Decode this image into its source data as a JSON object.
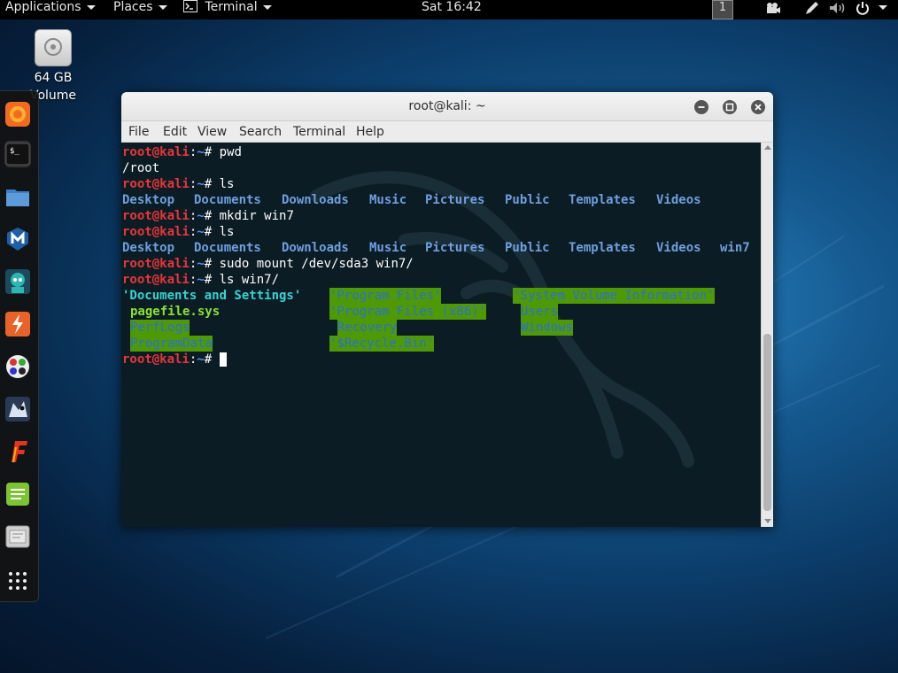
{
  "topbar": {
    "applications_label": "Applications",
    "places_label": "Places",
    "terminal_label": "Terminal",
    "clock": "Sat 16:42",
    "workspace": "1"
  },
  "desktop": {
    "volume_label_line1": "64 GB",
    "volume_label_line2": "Volume"
  },
  "dock": {
    "items": [
      "firefox-icon",
      "terminal-icon",
      "files-icon",
      "metasploit-icon",
      "armitage-icon",
      "burpsuite-icon",
      "maltego-icon",
      "beef-icon",
      "faraday-icon",
      "leafpad-icon",
      "cherrytree-icon",
      "show-apps-icon"
    ]
  },
  "window": {
    "title": "root@kali: ~",
    "menu": [
      "File",
      "Edit",
      "View",
      "Search",
      "Terminal",
      "Help"
    ]
  },
  "terminal": {
    "prompt_user": "root@kali",
    "prompt_colon": ":",
    "prompt_path": "~",
    "prompt_hash": "# ",
    "cmd1": "pwd",
    "out_pwd": "/root",
    "cmd2": "ls",
    "ls1": [
      "Desktop",
      "Documents",
      "Downloads",
      "Music",
      "Pictures",
      "Public",
      "Templates",
      "Videos"
    ],
    "cmd3": "mkdir win7",
    "cmd4": "ls",
    "ls2": [
      "Desktop",
      "Documents",
      "Downloads",
      "Music",
      "Pictures",
      "Public",
      "Templates",
      "Videos",
      "win7"
    ],
    "cmd5": "sudo mount /dev/sda3 win7/",
    "cmd6": "ls win7/",
    "win7": {
      "documents_and_settings": "'Documents and Settings'",
      "program_files": "'Program Files'",
      "system_volume_information": "'System Volume Information'",
      "pagefile": "pagefile.sys",
      "program_files_x86": "'Program Files (x86)'",
      "users": "Users",
      "perflogs": "PerfLogs",
      "recovery": "Recovery",
      "windows": "Windows",
      "programdata": "ProgramData",
      "recycle_bin": "'$Recycle.Bin'"
    }
  },
  "colors": {
    "terminal_bg": "#0c1c24",
    "prompt_user": "#e8363b",
    "prompt_path": "#5c8df0",
    "directory": "#6f9fe0",
    "other_writable_bg": "#4e9a06",
    "executable": "#8ae234",
    "cyan_dir": "#36d3d3"
  }
}
